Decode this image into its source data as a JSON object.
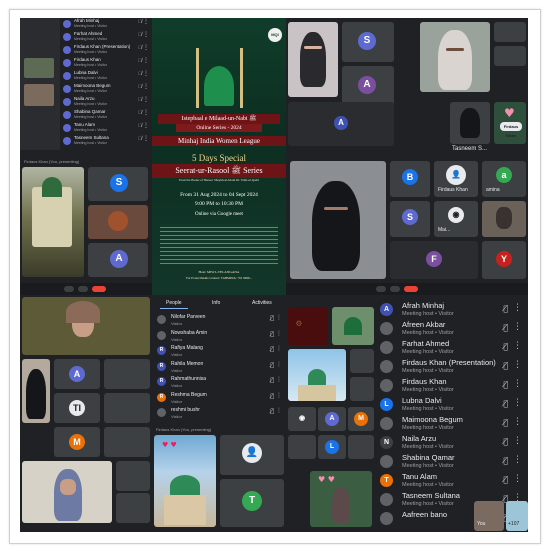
{
  "poster": {
    "event_title": "Istepbaal e Milaad-un-Nabi ﷺ",
    "series_label": "Online Series - 2024",
    "org": "Minhaj India Women League",
    "special_title": "5 Days Special",
    "series_name": "Seerat-ur-Rasool ﷺ Series",
    "from_books": "From the Books of Huzoor Shaykh-ul-Islam Dr. Tahir-ul-Qadri",
    "dates": "From 31 Aug 2024 to 04 Sept 2024",
    "time": "9:00 PM to 10:30 PM",
    "platform": "Online via Google meet",
    "footer_org": "Host: MIWL-TELANGANA",
    "footer_contact": "For Event Details Contact: TAHMINA: +91 9999..."
  },
  "participants_panel": {
    "tabs": [
      "People",
      "Info",
      "Activities"
    ],
    "items": [
      {
        "name": "Nilofar Parveen",
        "role": "Visitor",
        "initial": "",
        "color": "#5f6368"
      },
      {
        "name": "Nowshaba Amin",
        "role": "Visitor",
        "initial": "",
        "color": "#5f6368"
      },
      {
        "name": "Rafiya Malang",
        "role": "Visitor",
        "initial": "R",
        "color": "#3f51b5"
      },
      {
        "name": "Rahila Memon",
        "role": "Visitor",
        "initial": "R",
        "color": "#3f51b5"
      },
      {
        "name": "Rahmathunnisa",
        "role": "Visitor",
        "initial": "R",
        "color": "#3f51b5"
      },
      {
        "name": "Reshma Begum",
        "role": "Visitor",
        "initial": "R",
        "color": "#e8710a"
      },
      {
        "name": "reshmi bushr",
        "role": "Visitor",
        "initial": "",
        "color": "#5f6368"
      }
    ]
  },
  "host_list": {
    "items": [
      {
        "name": "Afrah Minhaj",
        "role": "Meeting host • Visitor",
        "initial": "A",
        "color": "#3f51b5"
      },
      {
        "name": "Afreen Akbar",
        "role": "Meeting host • Visitor",
        "initial": "",
        "color": "#5f6368"
      },
      {
        "name": "Farhat Ahmed",
        "role": "Meeting host • Visitor",
        "initial": "",
        "color": "#5f6368"
      },
      {
        "name": "Firdaus Khan (Presentation)",
        "role": "Meeting host • Visitor",
        "initial": "",
        "color": "#5f6368"
      },
      {
        "name": "Firdaus Khan",
        "role": "Meeting host • Visitor",
        "initial": "",
        "color": "#5f6368"
      },
      {
        "name": "Lubna Dalvi",
        "role": "Meeting host • Visitor",
        "initial": "L",
        "color": "#1a73e8"
      },
      {
        "name": "Maimoona Begum",
        "role": "Meeting host • Visitor",
        "initial": "",
        "color": "#5f6368"
      },
      {
        "name": "Naila Arzu",
        "role": "Meeting host • Visitor",
        "initial": "N",
        "color": "#3c4043"
      },
      {
        "name": "Shabina Qamar",
        "role": "Meeting host • Visitor",
        "initial": "",
        "color": "#5f6368"
      },
      {
        "name": "Tanu Alam",
        "role": "Meeting host • Visitor",
        "initial": "T",
        "color": "#e8710a"
      },
      {
        "name": "Tasneem Sultana",
        "role": "Meeting host • Visitor",
        "initial": "",
        "color": "#5f6368"
      },
      {
        "name": "Aafreen bano",
        "role": "",
        "initial": "",
        "color": "#5f6368"
      }
    ],
    "self_label": "You",
    "more_count": "+107"
  },
  "topleft_list": {
    "items": [
      {
        "name": "Afrah Minhaj",
        "role": "Meeting host • Visitor"
      },
      {
        "name": "Farhat Ahmed",
        "role": "Meeting host • Visitor"
      },
      {
        "name": "Firdaus Khan (Presentation)",
        "role": "Meeting host • Visitor"
      },
      {
        "name": "Firdaus Khan",
        "role": "Meeting host • Visitor"
      },
      {
        "name": "Lubna Dalvi",
        "role": "Meeting host • Visitor"
      },
      {
        "name": "Maimoona Begum",
        "role": "Meeting host • Visitor"
      },
      {
        "name": "Naila Arzu",
        "role": "Meeting host • Visitor"
      },
      {
        "name": "Shabina Qamar",
        "role": "Meeting host • Visitor"
      },
      {
        "name": "Tanu Alam",
        "role": "Meeting host • Visitor"
      },
      {
        "name": "Tasneem Sultana",
        "role": "Meeting host • Visitor"
      }
    ]
  },
  "tiles": {
    "taslneem_label": "Tasneem S...",
    "firdaus_label": "Firdaus Khan",
    "amina_label": "amina",
    "mai_label": "Mai...",
    "you_label": "You",
    "presenting": "Firdaus Khan (You, presenting)"
  }
}
